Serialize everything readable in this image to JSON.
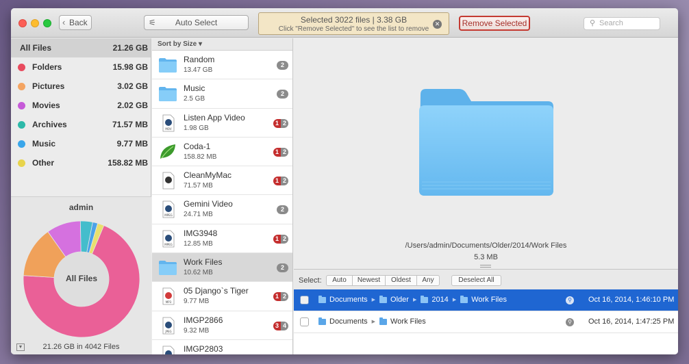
{
  "toolbar": {
    "back_label": "Back",
    "auto_select_label": "Auto Select",
    "status_line1": "Selected 3022 files | 3.38 GB",
    "status_line2": "Click \"Remove Selected\" to see the list to remove",
    "remove_label": "Remove Selected",
    "search_placeholder": "Search"
  },
  "sidebar": {
    "all_files": {
      "label": "All Files",
      "size": "21.26 GB"
    },
    "categories": [
      {
        "label": "Folders",
        "size": "15.98 GB",
        "color": "#e84b5e"
      },
      {
        "label": "Pictures",
        "size": "3.02 GB",
        "color": "#f4a462"
      },
      {
        "label": "Movies",
        "size": "2.02 GB",
        "color": "#c65ad8"
      },
      {
        "label": "Archives",
        "size": "71.57 MB",
        "color": "#2db9a9"
      },
      {
        "label": "Music",
        "size": "9.77 MB",
        "color": "#3aa6ea"
      },
      {
        "label": "Other",
        "size": "158.82 MB",
        "color": "#e8d44c"
      }
    ],
    "user": "admin",
    "donut_label": "All Files",
    "donut_fractions": [
      0.752,
      0.142,
      0.095,
      0.034,
      0.014,
      0.018
    ],
    "donut_colors": [
      "#ea6097",
      "#f0a15a",
      "#d571df",
      "#44bdcc",
      "#4ba3e8",
      "#e9e06d"
    ],
    "footer": "21.26 GB in 4042 Files"
  },
  "filelist": {
    "sort_label": "Sort by Size ▾",
    "items": [
      {
        "name": "Random",
        "size": "13.47 GB",
        "icon": "folder-icon",
        "red": "",
        "gray": "2"
      },
      {
        "name": "Music",
        "size": "2.5 GB",
        "icon": "folder-icon",
        "red": "",
        "gray": "2"
      },
      {
        "name": "Listen App Video",
        "size": "1.98 GB",
        "icon": "mov-file-icon",
        "red": "1",
        "gray": "2"
      },
      {
        "name": "Coda-1",
        "size": "158.82 MB",
        "icon": "coda-leaf-icon",
        "red": "1",
        "gray": "2"
      },
      {
        "name": "CleanMyMac",
        "size": "71.57 MB",
        "icon": "archive-file-icon",
        "red": "1",
        "gray": "2"
      },
      {
        "name": "Gemini Video",
        "size": "24.71 MB",
        "icon": "mpeg-file-icon",
        "red": "",
        "gray": "2"
      },
      {
        "name": "IMG3948",
        "size": "12.85 MB",
        "icon": "mpeg-file-icon",
        "red": "1",
        "gray": "2"
      },
      {
        "name": "Work Files",
        "size": "10.62 MB",
        "icon": "folder-icon",
        "red": "",
        "gray": "2",
        "selected": true
      },
      {
        "name": "05 Django`s Tiger",
        "size": "9.77 MB",
        "icon": "mp3-file-icon",
        "red": "1",
        "gray": "2"
      },
      {
        "name": "IMGP2866",
        "size": "9.32 MB",
        "icon": "jpeg-file-icon",
        "red": "3",
        "gray": "4"
      },
      {
        "name": "IMGP2803",
        "size": "",
        "icon": "jpeg-file-icon",
        "red": "",
        "gray": ""
      }
    ]
  },
  "preview": {
    "path": "/Users/admin/Documents/Older/2014/Work Files",
    "size": "5.3 MB"
  },
  "selectbar": {
    "label": "Select:",
    "buttons": [
      "Auto",
      "Newest",
      "Oldest",
      "Any"
    ],
    "deselect": "Deselect All"
  },
  "duplicates": [
    {
      "crumbs": [
        "Documents",
        "Older",
        "2014",
        "Work Files"
      ],
      "date": "Oct 16, 2014, 1:46:10 PM",
      "selected": true
    },
    {
      "crumbs": [
        "Documents",
        "Work Files"
      ],
      "date": "Oct 16, 2014, 1:47:25 PM",
      "selected": false
    }
  ]
}
